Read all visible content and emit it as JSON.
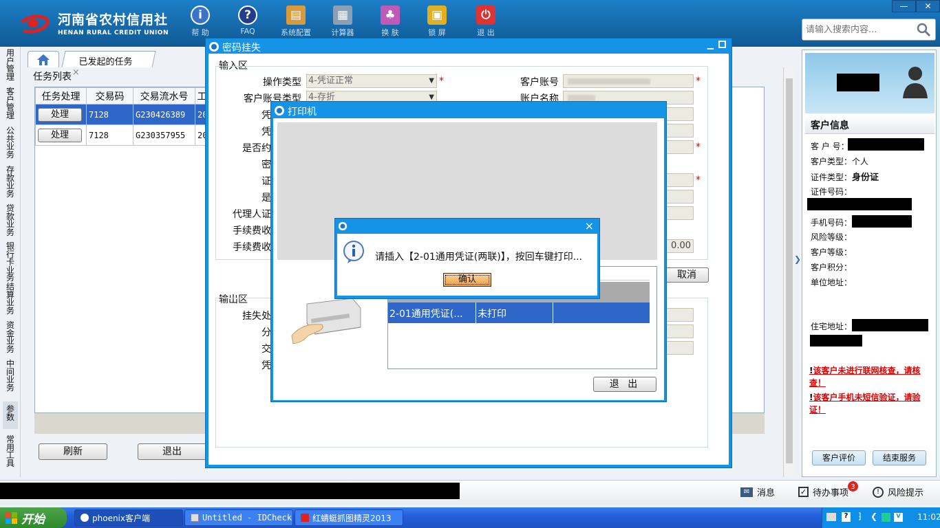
{
  "app": {
    "logo_cn": "河南省农村信用社",
    "logo_en": "HENAN RURAL CREDIT UNION",
    "toolbar": [
      "帮 助",
      "FAQ",
      "系统配置",
      "计算器",
      "换 肤",
      "锁 屏",
      "退 出"
    ],
    "search_placeholder": "请输入搜索内容..."
  },
  "left_menu": [
    "用户管理",
    "客户管理",
    "公共业务",
    "存款业务",
    "贷款业务",
    "银行卡业务",
    "结算业务",
    "资金业务",
    "中间业务",
    "参数",
    "常用工具"
  ],
  "tabs": {
    "home_icon": "home-icon",
    "active_tab": "已发起的任务",
    "close_glyph": "×"
  },
  "task_list": {
    "title": "任务列表",
    "columns": [
      "任务处理",
      "交易码",
      "交易流水号",
      "工"
    ],
    "rows": [
      {
        "action": "处理",
        "code": "7128",
        "serial": "G230426389",
        "extra": "20"
      },
      {
        "action": "处理",
        "code": "7128",
        "serial": "G230357955",
        "extra": "20"
      }
    ],
    "refresh": "刷新",
    "exit": "退出"
  },
  "password_dialog": {
    "title": "密码挂失",
    "input_section": "输入区",
    "output_section": "输出区",
    "left_labels": [
      "操作类型",
      "客户账号类型",
      "凭",
      "凭",
      "是否约",
      "密",
      "证",
      "是",
      "代理人证",
      "手续费收",
      "手续费收"
    ],
    "op_type_value": "4-凭证正常",
    "account_type_value": "4-存折",
    "right_labels": [
      "客户账号",
      "账户名称"
    ],
    "fee_value": "0.00",
    "cancel": "取消",
    "output_labels": [
      "挂失处",
      "分",
      "交",
      "凭"
    ]
  },
  "printer_dialog": {
    "title": "打印机",
    "voucher_name": "2-01通用凭证(...",
    "voucher_status": "未打印",
    "exit": "退 出"
  },
  "message_dialog": {
    "message": "请插入【2-01通用凭证(两联)】，按回车键打印...",
    "confirm": "确认",
    "close_glyph": "×"
  },
  "customer_panel": {
    "section_title": "客户信息",
    "fields": [
      {
        "label": "客 户 号：",
        "value": ""
      },
      {
        "label": "客户类型：",
        "value": "个人"
      },
      {
        "label": "证件类型：",
        "value": "身份证"
      },
      {
        "label": "证件号码：",
        "value": ""
      },
      {
        "label": "手机号码：",
        "value": ""
      },
      {
        "label": "风险等级：",
        "value": ""
      },
      {
        "label": "客户等级：",
        "value": ""
      },
      {
        "label": "客户积分：",
        "value": ""
      },
      {
        "label": "单位地址：",
        "value": ""
      },
      {
        "label": "住宅地址：",
        "value": ""
      }
    ],
    "warnings": [
      "该客户未进行联网核查，请核查！",
      "该客户手机未短信验证，请验证！"
    ],
    "evaluate": "客户评价",
    "end_service": "结束服务"
  },
  "status_bar": {
    "messages": "消息",
    "todo": "待办事项",
    "todo_count": "3",
    "risk": "风险提示"
  },
  "taskbar": {
    "start": "开始",
    "items": [
      "phoenix客户端",
      "Untitled - IDCheck",
      "红蜻蜓抓图精灵2013"
    ],
    "clock": "11:02"
  }
}
